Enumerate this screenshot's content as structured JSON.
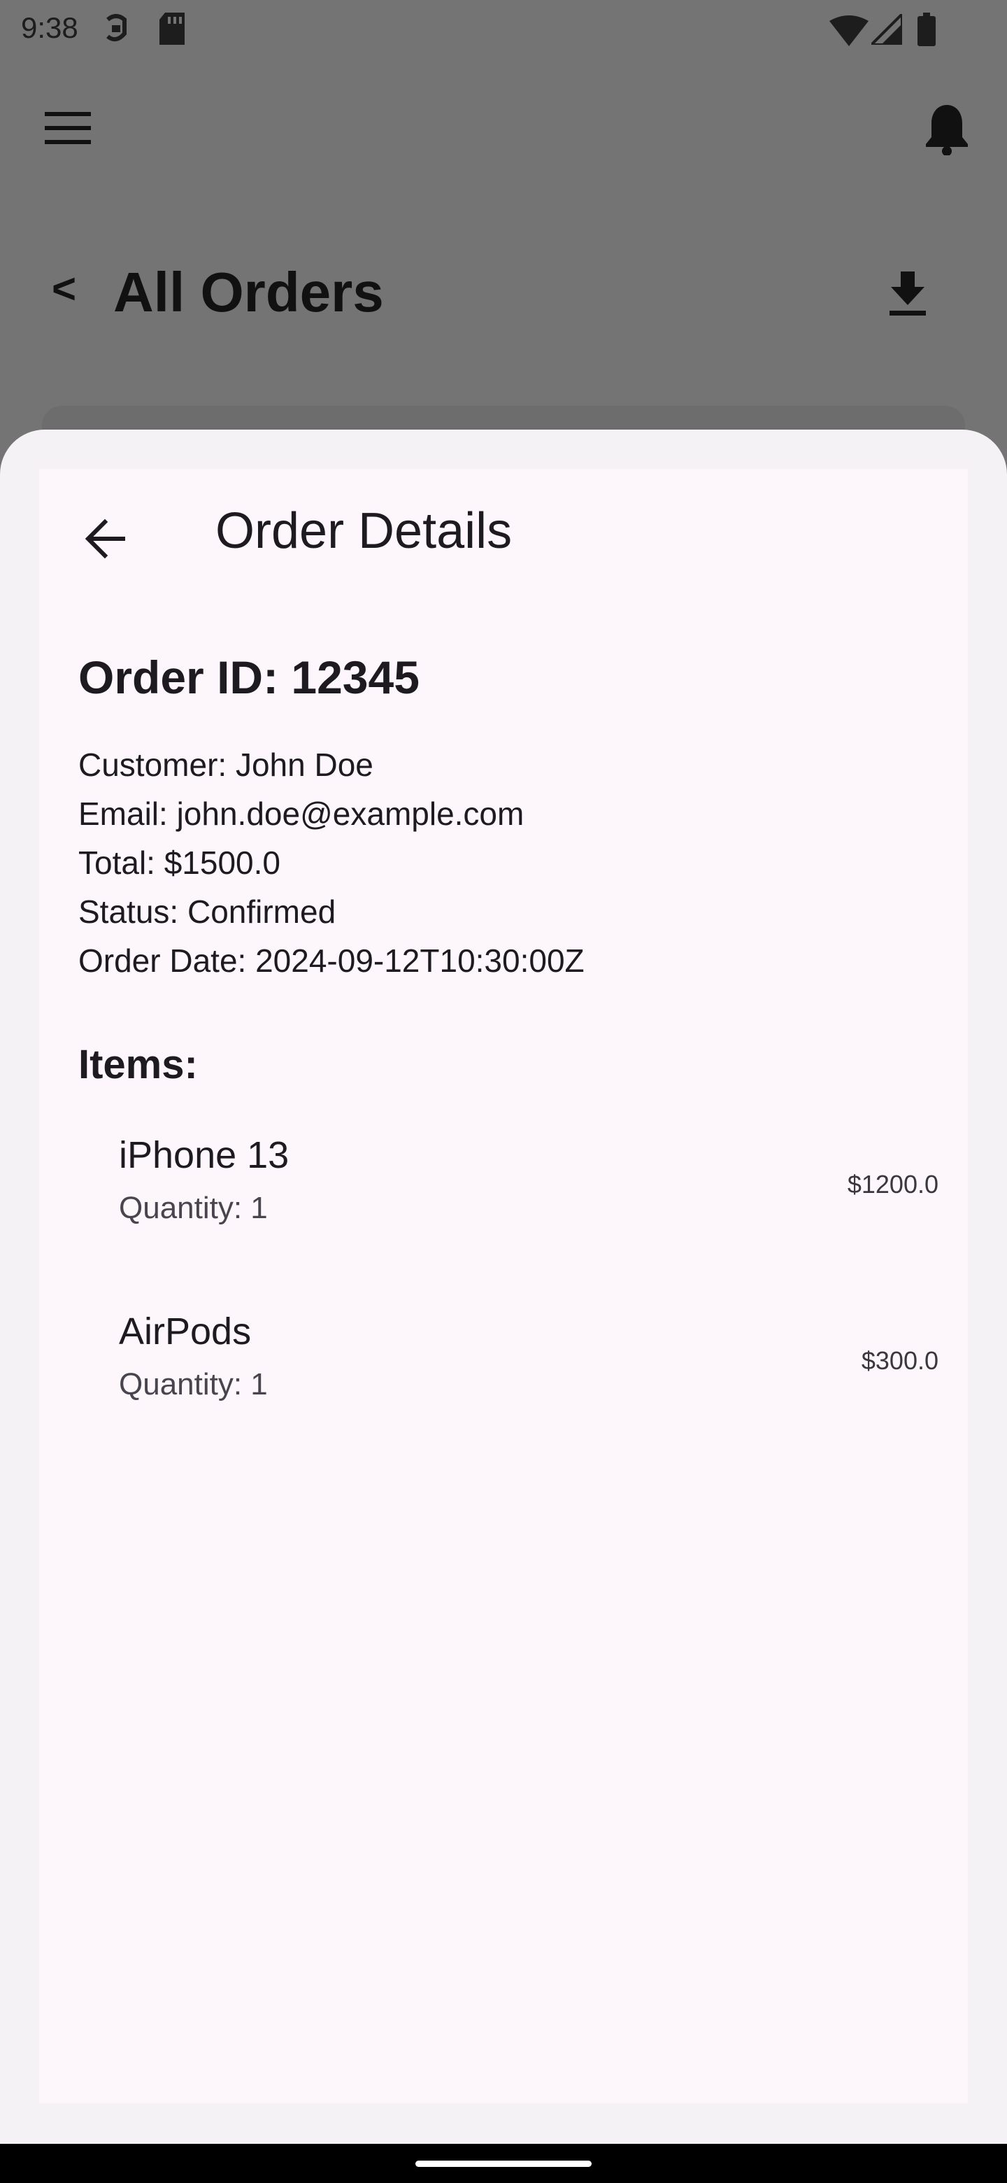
{
  "status_bar": {
    "time": "9:38",
    "left_icons": [
      "sync-icon",
      "sd-card-icon"
    ],
    "right_icons": [
      "wifi-icon",
      "signal-icon",
      "battery-icon"
    ]
  },
  "app_bar": {
    "menu_icon": "menu-icon",
    "notification_icon": "bell-icon"
  },
  "background_page": {
    "back_label": "<",
    "title": "All Orders",
    "download_icon": "download-icon"
  },
  "sheet": {
    "title": "Order Details",
    "back_icon": "arrow-back-icon",
    "order_id": "Order ID: 12345",
    "info": {
      "customer": "Customer: John Doe",
      "email": "Email: john.doe@example.com",
      "total": "Total: $1500.0",
      "status": "Status: Confirmed",
      "order_date": "Order Date: 2024-09-12T10:30:00Z"
    },
    "items_heading": "Items:",
    "items": [
      {
        "name": "iPhone 13",
        "quantity": "Quantity: 1",
        "price": "$1200.0"
      },
      {
        "name": "AirPods",
        "quantity": "Quantity: 1",
        "price": "$300.0"
      }
    ]
  },
  "colors": {
    "scrim": "#747474",
    "sheet": "#f4f2f5",
    "surface": "#fdf7fc",
    "text": "#1d1b20",
    "secondary_text": "#49454f"
  }
}
